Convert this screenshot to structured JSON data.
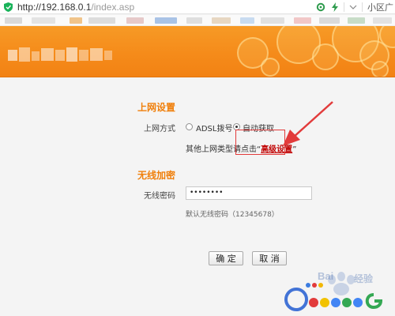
{
  "browser": {
    "url_host": "http://192.168.0.1",
    "url_path": "/index.asp",
    "right_label": "小区广"
  },
  "internet": {
    "title": "上网设置",
    "mode_label": "上网方式",
    "options": [
      {
        "label": "ADSL拨号",
        "checked": false
      },
      {
        "label": "自动获取",
        "checked": true
      }
    ],
    "hint_prefix": "其他上网类型请点击",
    "hint_open_quote": "“",
    "hint_link": "高级设置",
    "hint_close_quote": "”"
  },
  "wireless": {
    "title": "无线加密",
    "password_label": "无线密码",
    "password_value": "••••••••",
    "default_hint": "默认无线密码（12345678）"
  },
  "buttons": {
    "ok": "确 定",
    "cancel": "取 消"
  },
  "watermark": {
    "text_a": "Bai",
    "text_b": "经验",
    "logo_letter": "G",
    "tail_letter": "g"
  },
  "colors": {
    "accent_orange": "#f07f0a",
    "banner_orange": "#f58b1a",
    "annotation_red": "#e23b3b",
    "link_red": "#c00000"
  }
}
